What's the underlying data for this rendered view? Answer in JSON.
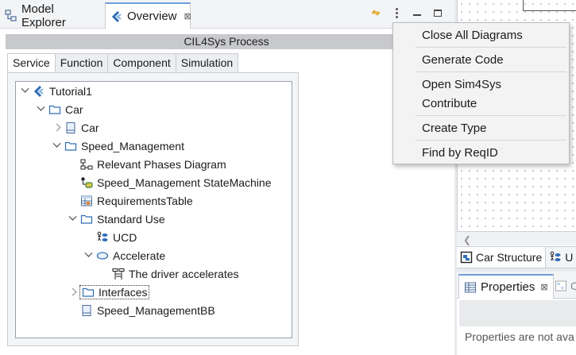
{
  "left_view": {
    "tabs": [
      {
        "label": "Model Explorer"
      },
      {
        "label": "Overview",
        "close": "⊠"
      }
    ]
  },
  "process_title": "CIL4Sys Process",
  "subtabs": [
    "Service",
    "Function",
    "Component",
    "Simulation"
  ],
  "tree": [
    {
      "label": "Tutorial1"
    },
    {
      "label": "Car"
    },
    {
      "label": "Car"
    },
    {
      "label": "Speed_Management"
    },
    {
      "label": "Relevant Phases Diagram"
    },
    {
      "label": "Speed_Management StateMachine"
    },
    {
      "label": "RequirementsTable"
    },
    {
      "label": "Standard Use"
    },
    {
      "label": "UCD"
    },
    {
      "label": "Accelerate"
    },
    {
      "label": "The driver accelerates"
    },
    {
      "label": "Interfaces"
    },
    {
      "label": "Speed_ManagementBB"
    }
  ],
  "context_menu": {
    "items": [
      {
        "label": "Close All Diagrams"
      },
      {
        "label": "Generate Code"
      },
      {
        "label": "Open Sim4Sys"
      },
      {
        "label": "Contribute"
      },
      {
        "label": "Create Type"
      },
      {
        "label": "Find by ReqID"
      }
    ]
  },
  "bottom_tabs": [
    {
      "label": "Car Structure"
    },
    {
      "label": "U"
    }
  ],
  "properties": {
    "tab_label": "Properties",
    "tab_close": "⊠",
    "second_tab_label": "C",
    "message": "Properties are not ava"
  },
  "colors": {
    "folder": "#2f6db5",
    "accent": "#6d9fd8",
    "selection_outline": "#333333"
  },
  "icons": {
    "model_explorer": "model-explorer-icon",
    "overview": "overview-icon",
    "link": "link-icon",
    "view_menu": "view-menu-icon",
    "minimize": "minimize-icon",
    "maximize": "maximize-icon"
  }
}
